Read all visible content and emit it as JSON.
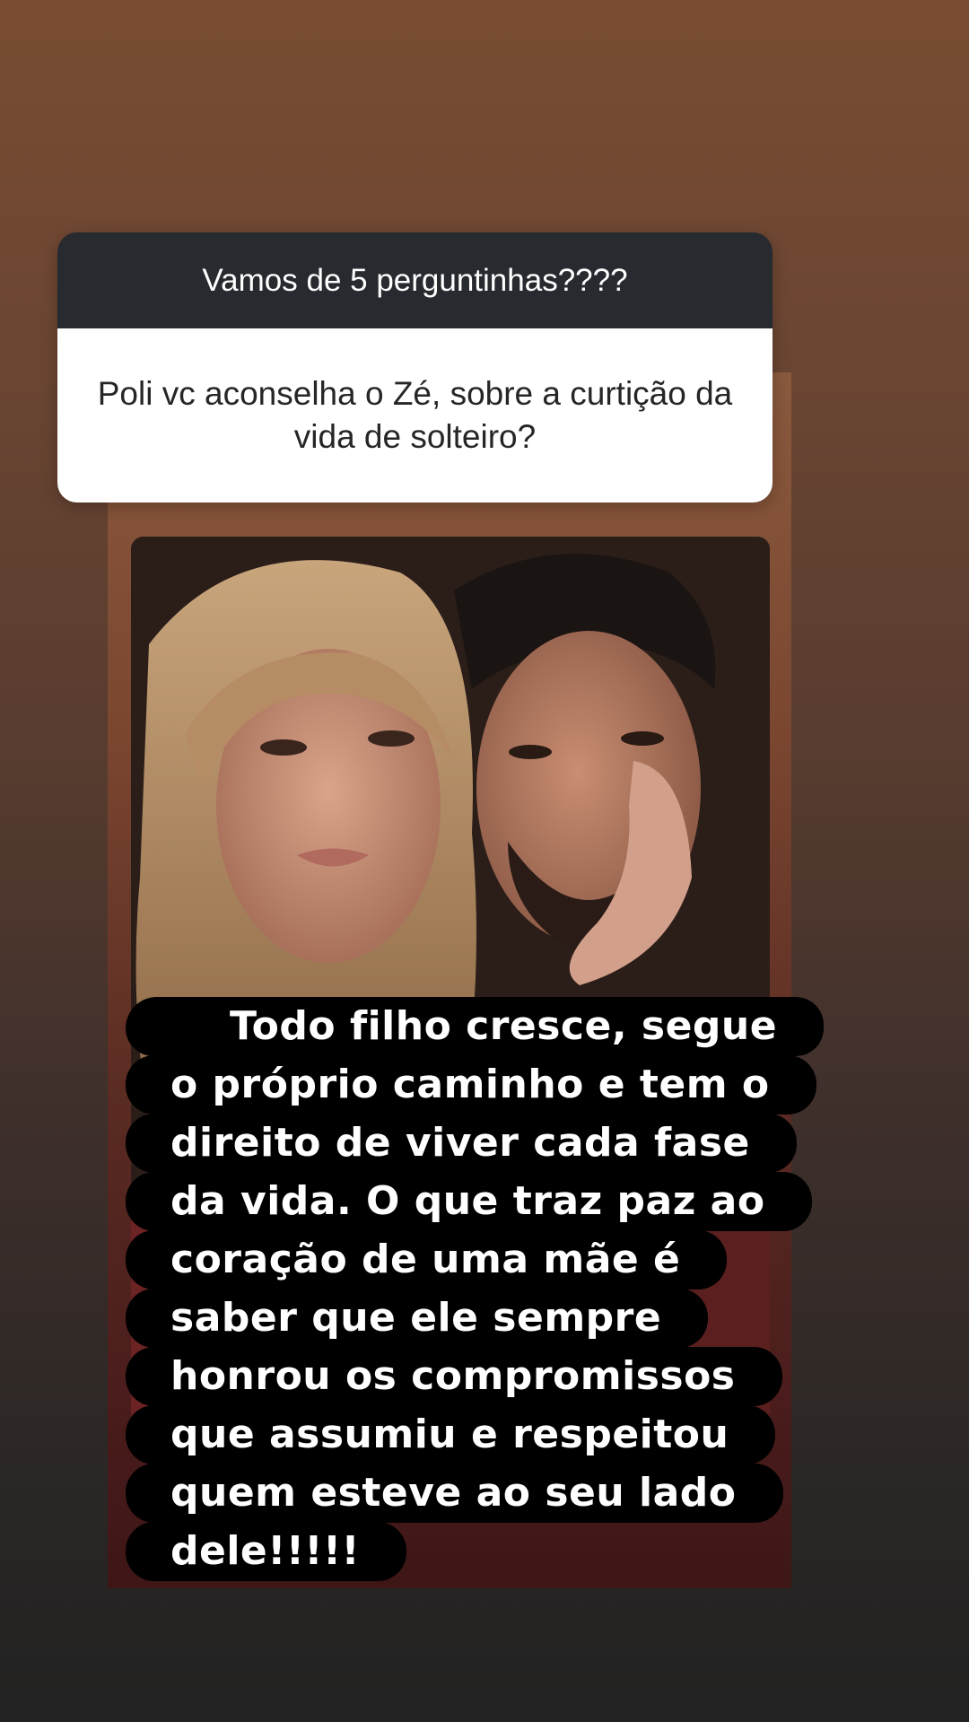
{
  "question_sticker": {
    "header": "Vamos de 5 perguntinhas????",
    "question": "Poli vc aconselha o Zé, sobre a curtição da vida de solteiro?"
  },
  "photo": {
    "description_icon": "couple-photo"
  },
  "answer_lines": [
    "Todo filho cresce, segue",
    "o próprio caminho e tem o",
    "direito de viver cada fase",
    "da vida. O que traz paz ao",
    "coração de uma mãe é",
    "saber que ele sempre",
    "honrou os compromissos",
    "que assumiu e respeitou",
    "quem esteve ao seu lado",
    "dele!!!!!"
  ]
}
